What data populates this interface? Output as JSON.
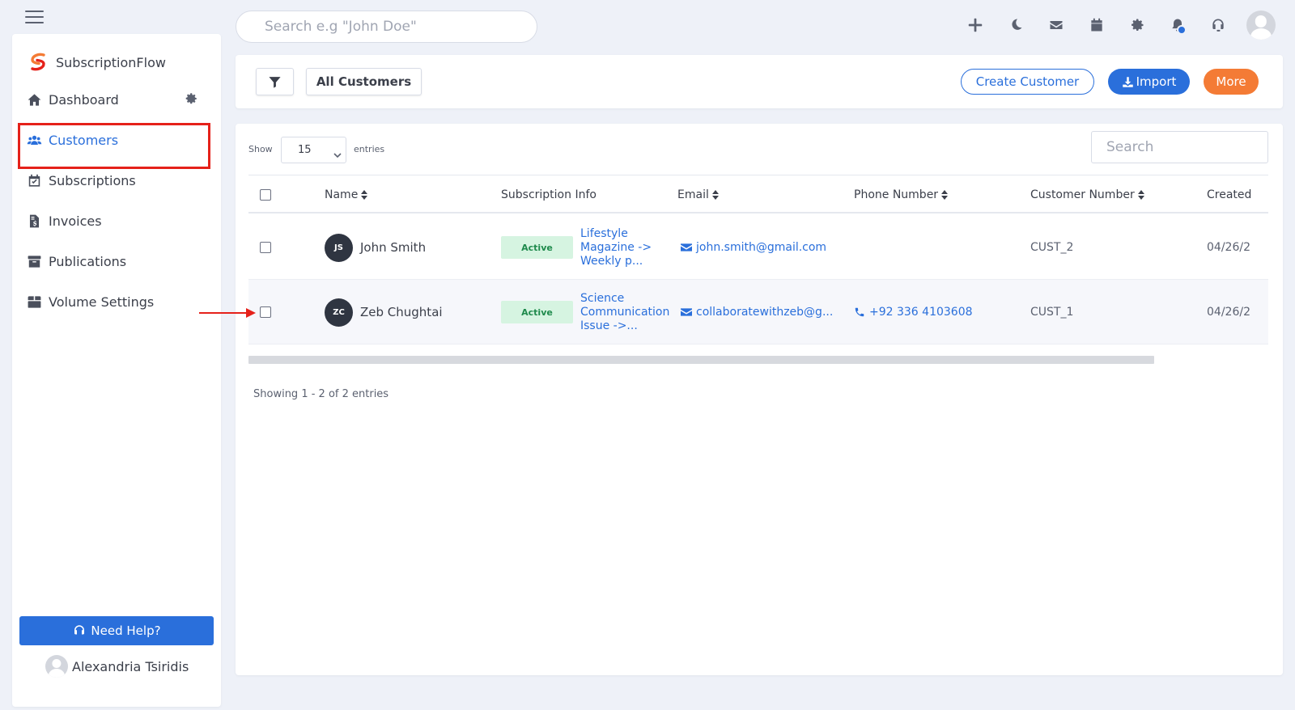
{
  "top_search": {
    "placeholder": "Search e.g \"John Doe\""
  },
  "top_icons": [
    "plus-icon",
    "moon-icon",
    "mail-icon",
    "calendar-icon",
    "gear-icon",
    "bell-icon",
    "headset-icon"
  ],
  "brand": {
    "name": "SubscriptionFlow",
    "logo_color": "#f47b35",
    "logo_color2": "#e5211a"
  },
  "sidebar": {
    "items": [
      {
        "label": "Dashboard",
        "icon": "home-icon"
      },
      {
        "label": "Customers",
        "icon": "users-icon",
        "active": true
      },
      {
        "label": "Subscriptions",
        "icon": "calendar-check-icon"
      },
      {
        "label": "Invoices",
        "icon": "invoice-icon"
      },
      {
        "label": "Publications",
        "icon": "archive-icon"
      },
      {
        "label": "Volume Settings",
        "icon": "boxes-icon"
      }
    ],
    "help_label": "Need Help?",
    "user_name": "Alexandria Tsiridis"
  },
  "toolbar": {
    "all_customers_label": "All Customers",
    "create_label": "Create Customer",
    "import_label": "Import",
    "more_label": "More"
  },
  "table": {
    "show_label": "Show",
    "entries_value": "15",
    "entries_label": "entries",
    "search_placeholder": "Search",
    "columns": [
      "Name",
      "Subscription Info",
      "Email",
      "Phone Number",
      "Customer Number",
      "Created"
    ],
    "rows": [
      {
        "initials": "JS",
        "name": "John Smith",
        "status": "Active",
        "subscription": "Lifestyle Magazine -> Weekly p...",
        "email": "john.smith@gmail.com",
        "phone": "",
        "customer_number": "CUST_2",
        "created": "04/26/2"
      },
      {
        "initials": "ZC",
        "name": "Zeb Chughtai",
        "status": "Active",
        "subscription": "Science Communication Issue ->...",
        "email": "collaboratewithzeb@g...",
        "phone": "+92 336 4103608",
        "customer_number": "CUST_1",
        "created": "04/26/2"
      }
    ],
    "showing_text": "Showing 1 - 2 of 2 entries"
  },
  "colors": {
    "primary": "#2a6fdb",
    "accent_orange": "#f47b35",
    "active_badge_bg": "#d6f4e1",
    "active_badge_text": "#1f8a4c",
    "highlight_red": "#e5211a"
  }
}
